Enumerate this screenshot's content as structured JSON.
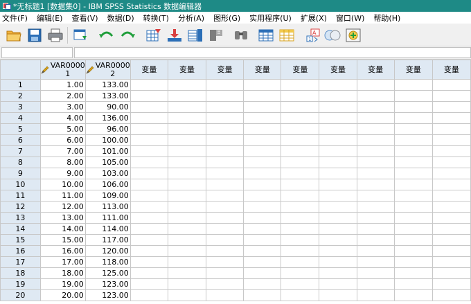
{
  "window": {
    "title": "*无标题1 [数据集0] - IBM SPSS Statistics 数据编辑器"
  },
  "menubar": {
    "items": [
      "文件(F)",
      "编辑(E)",
      "查看(V)",
      "数据(D)",
      "转换(T)",
      "分析(A)",
      "图形(G)",
      "实用程序(U)",
      "扩展(X)",
      "窗口(W)",
      "帮助(H)"
    ]
  },
  "toolbar": {
    "buttons": [
      {
        "name": "open-folder-icon"
      },
      {
        "name": "save-icon"
      },
      {
        "name": "print-icon"
      },
      {
        "name": "dialog-recall-icon"
      },
      {
        "name": "undo-icon"
      },
      {
        "name": "redo-icon"
      },
      {
        "name": "goto-case-icon"
      },
      {
        "name": "goto-variable-icon"
      },
      {
        "name": "variables-icon"
      },
      {
        "name": "run-descriptives-icon"
      },
      {
        "name": "find-icon"
      },
      {
        "name": "insert-cases-icon"
      },
      {
        "name": "insert-variable-icon"
      },
      {
        "name": "split-file-icon"
      },
      {
        "name": "select-cases-icon"
      },
      {
        "name": "value-labels-icon"
      }
    ]
  },
  "grid": {
    "columns": [
      {
        "line1": "VAR0000",
        "line2": "1",
        "type": "variable"
      },
      {
        "line1": "VAR0000",
        "line2": "2",
        "type": "variable"
      },
      {
        "label": "变量"
      },
      {
        "label": "变量"
      },
      {
        "label": "变量"
      },
      {
        "label": "变量"
      },
      {
        "label": "变量"
      },
      {
        "label": "变量"
      },
      {
        "label": "变量"
      },
      {
        "label": "变量"
      },
      {
        "label": "变量"
      }
    ],
    "rows": [
      {
        "n": "1",
        "v1": "1.00",
        "v2": "133.00"
      },
      {
        "n": "2",
        "v1": "2.00",
        "v2": "133.00"
      },
      {
        "n": "3",
        "v1": "3.00",
        "v2": "90.00"
      },
      {
        "n": "4",
        "v1": "4.00",
        "v2": "136.00"
      },
      {
        "n": "5",
        "v1": "5.00",
        "v2": "96.00"
      },
      {
        "n": "6",
        "v1": "6.00",
        "v2": "100.00"
      },
      {
        "n": "7",
        "v1": "7.00",
        "v2": "101.00"
      },
      {
        "n": "8",
        "v1": "8.00",
        "v2": "105.00"
      },
      {
        "n": "9",
        "v1": "9.00",
        "v2": "103.00"
      },
      {
        "n": "10",
        "v1": "10.00",
        "v2": "106.00"
      },
      {
        "n": "11",
        "v1": "11.00",
        "v2": "109.00"
      },
      {
        "n": "12",
        "v1": "12.00",
        "v2": "113.00"
      },
      {
        "n": "13",
        "v1": "13.00",
        "v2": "111.00"
      },
      {
        "n": "14",
        "v1": "14.00",
        "v2": "114.00"
      },
      {
        "n": "15",
        "v1": "15.00",
        "v2": "117.00"
      },
      {
        "n": "16",
        "v1": "16.00",
        "v2": "120.00"
      },
      {
        "n": "17",
        "v1": "17.00",
        "v2": "118.00"
      },
      {
        "n": "18",
        "v1": "18.00",
        "v2": "125.00"
      },
      {
        "n": "19",
        "v1": "19.00",
        "v2": "123.00"
      },
      {
        "n": "20",
        "v1": "20.00",
        "v2": "123.00"
      }
    ]
  },
  "colors": {
    "titlebar": "#1e8a86",
    "header": "#dfe9f3",
    "gridline": "#c8c8c8"
  }
}
